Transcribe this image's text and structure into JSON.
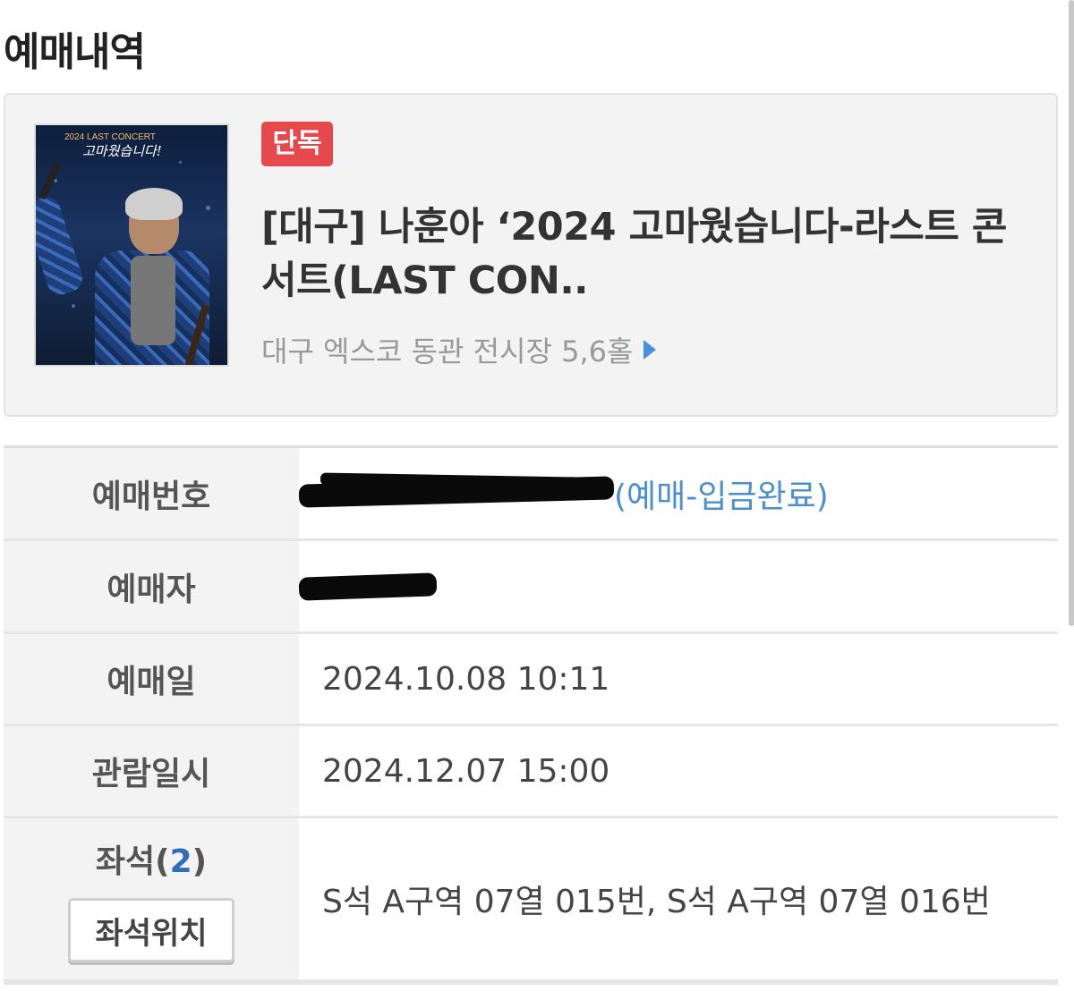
{
  "header": {
    "title": "예매내역"
  },
  "event": {
    "badge": "단독",
    "title": "[대구] 나훈아 ‘2024 고마웠습니다-라스트 콘서트(LAST CON..",
    "venue": "대구 엑스코 동관 전시장 5,6홀",
    "poster": {
      "top_text": "2024 LAST CONCERT",
      "title_text": "고마웠습니다!"
    }
  },
  "details": {
    "booking_number": {
      "label": "예매번호",
      "status": "(예매-입금완료)"
    },
    "booker": {
      "label": "예매자"
    },
    "booking_date": {
      "label": "예매일",
      "value": "2024.10.08 10:11"
    },
    "view_datetime": {
      "label": "관람일시",
      "value": "2024.12.07 15:00"
    },
    "seats": {
      "label": "좌석(",
      "count": "2",
      "label_close": ")",
      "button": "좌석위치",
      "value": "S석 A구역 07열 015번, S석 A구역 07열 016번"
    }
  },
  "colors": {
    "badge": "#e5484d",
    "link": "#4a8fd0",
    "seat_count": "#2e6fb8",
    "arrow": "#4a90e2"
  }
}
